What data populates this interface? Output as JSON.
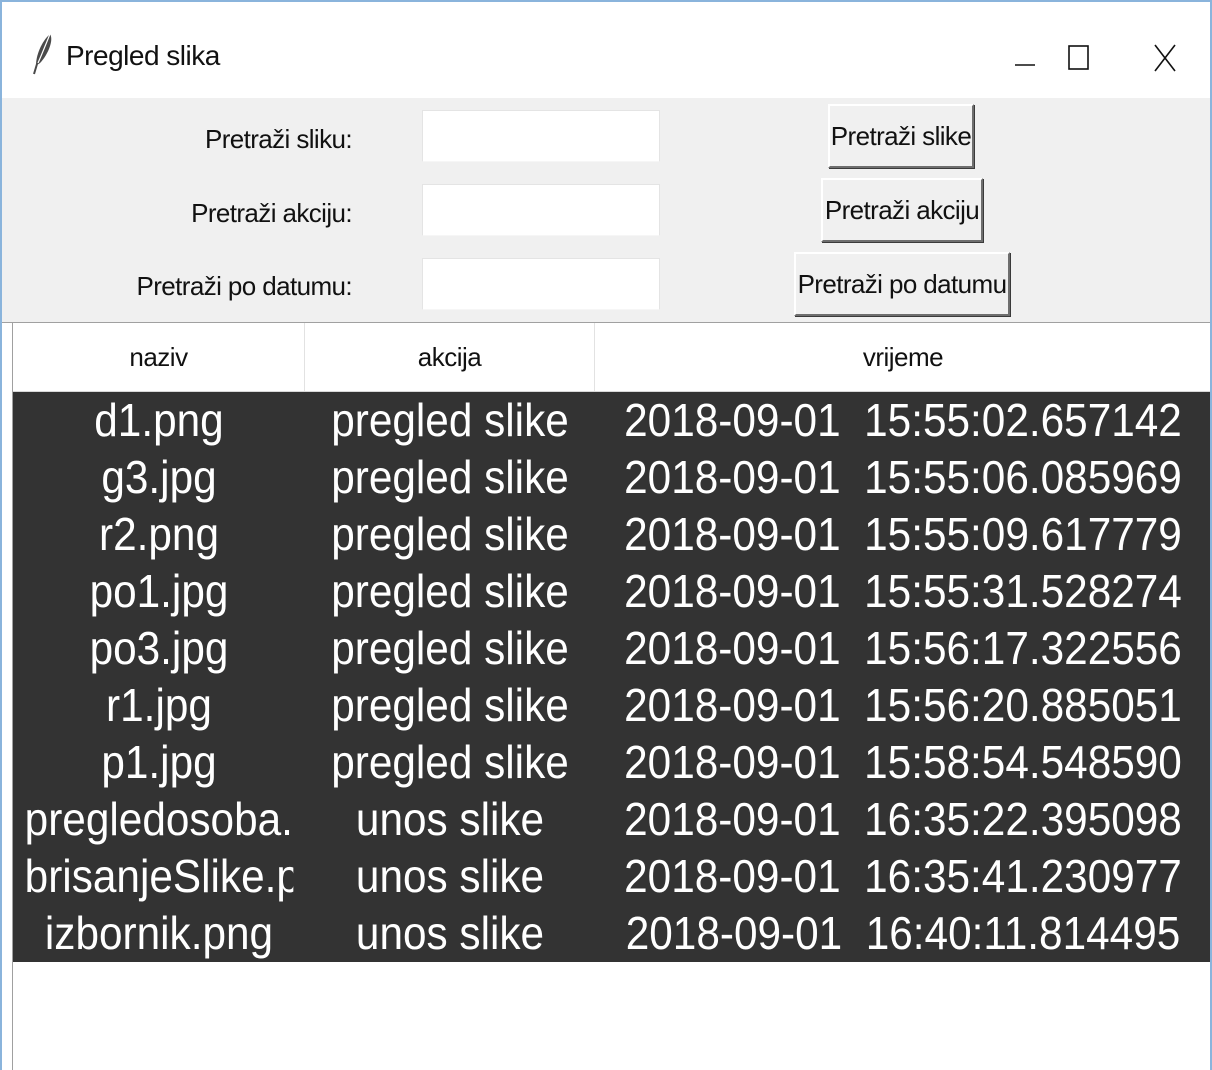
{
  "window": {
    "title": "Pregled slika",
    "icon": "feather-icon",
    "controls": [
      "minimize-icon",
      "maximize-icon",
      "close-icon"
    ]
  },
  "search": {
    "image_label": "Pretraži sliku:",
    "action_label": "Pretraži akciju:",
    "date_label": "Pretraži po datumu:",
    "image_value": "",
    "action_value": "",
    "date_value": "",
    "image_button": "Pretraži slike",
    "action_button": "Pretraži akciju",
    "date_button": "Pretraži po datumu"
  },
  "table": {
    "columns": [
      "naziv",
      "akcija",
      "vrijeme"
    ],
    "rows": [
      [
        "d1.png",
        "pregled slike",
        "2018-09-01  15:55:02.657142"
      ],
      [
        "g3.jpg",
        "pregled slike",
        "2018-09-01  15:55:06.085969"
      ],
      [
        "r2.png",
        "pregled slike",
        "2018-09-01  15:55:09.617779"
      ],
      [
        "po1.jpg",
        "pregled slike",
        "2018-09-01  15:55:31.528274"
      ],
      [
        "po3.jpg",
        "pregled slike",
        "2018-09-01  15:56:17.322556"
      ],
      [
        "r1.jpg",
        "pregled slike",
        "2018-09-01  15:56:20.885051"
      ],
      [
        "p1.jpg",
        "pregled slike",
        "2018-09-01  15:58:54.548590"
      ],
      [
        "pregledosoba.pr",
        "unos slike",
        "2018-09-01  16:35:22.395098"
      ],
      [
        "brisanjeSlike.pnc",
        "unos slike",
        "2018-09-01  16:35:41.230977"
      ],
      [
        "izbornik.png",
        "unos slike",
        "2018-09-01  16:40:11.814495"
      ]
    ]
  },
  "colors": {
    "row_background": "#333333",
    "row_text": "#ffffff",
    "panel_background": "#f0f0f0"
  }
}
